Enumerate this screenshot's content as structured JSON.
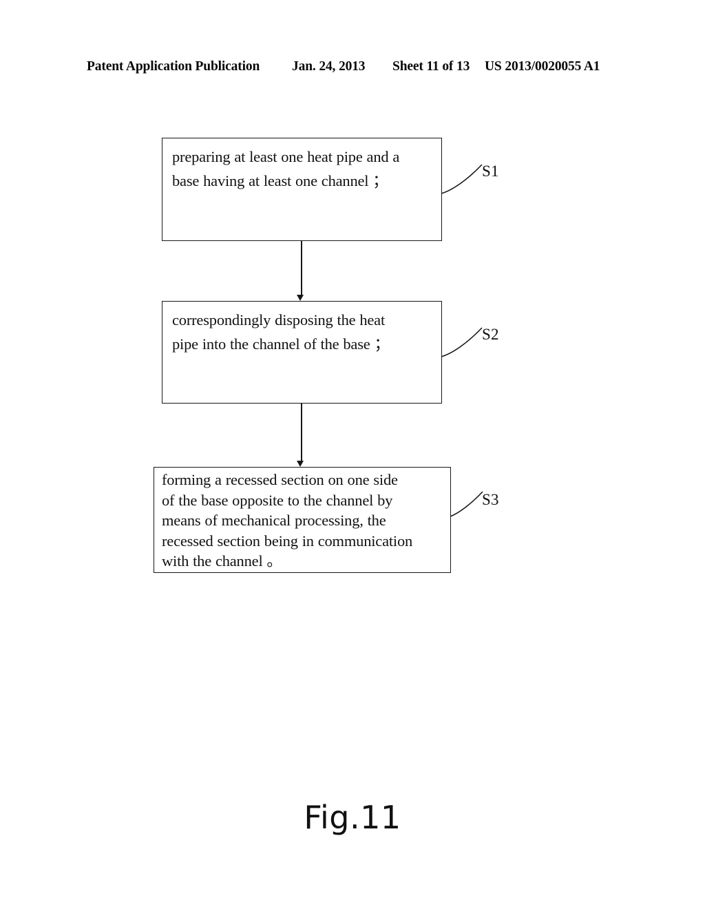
{
  "header": {
    "publication": "Patent Application Publication",
    "date": "Jan. 24, 2013",
    "sheet": "Sheet 11 of 13",
    "publication_number": "US 2013/0020055 A1"
  },
  "figure": {
    "caption": "Fig.11"
  },
  "flowchart": {
    "steps": [
      {
        "id": "S1",
        "label": "S1",
        "text": "preparing at least one heat pipe and a\nbase having at least one channel ；"
      },
      {
        "id": "S2",
        "label": "S2",
        "text": "correspondingly disposing the heat\npipe into the channel of the base ；"
      },
      {
        "id": "S3",
        "label": "S3",
        "text": "forming a recessed section on one side\nof the base opposite to the channel by\nmeans of mechanical processing, the\nrecessed section being in communication\nwith the channel 。"
      }
    ],
    "connectors": [
      {
        "from": "S1",
        "to": "S2"
      },
      {
        "from": "S2",
        "to": "S3"
      }
    ]
  },
  "colors": {
    "ink": "#111111",
    "line": "#171717",
    "background": "#ffffff"
  }
}
